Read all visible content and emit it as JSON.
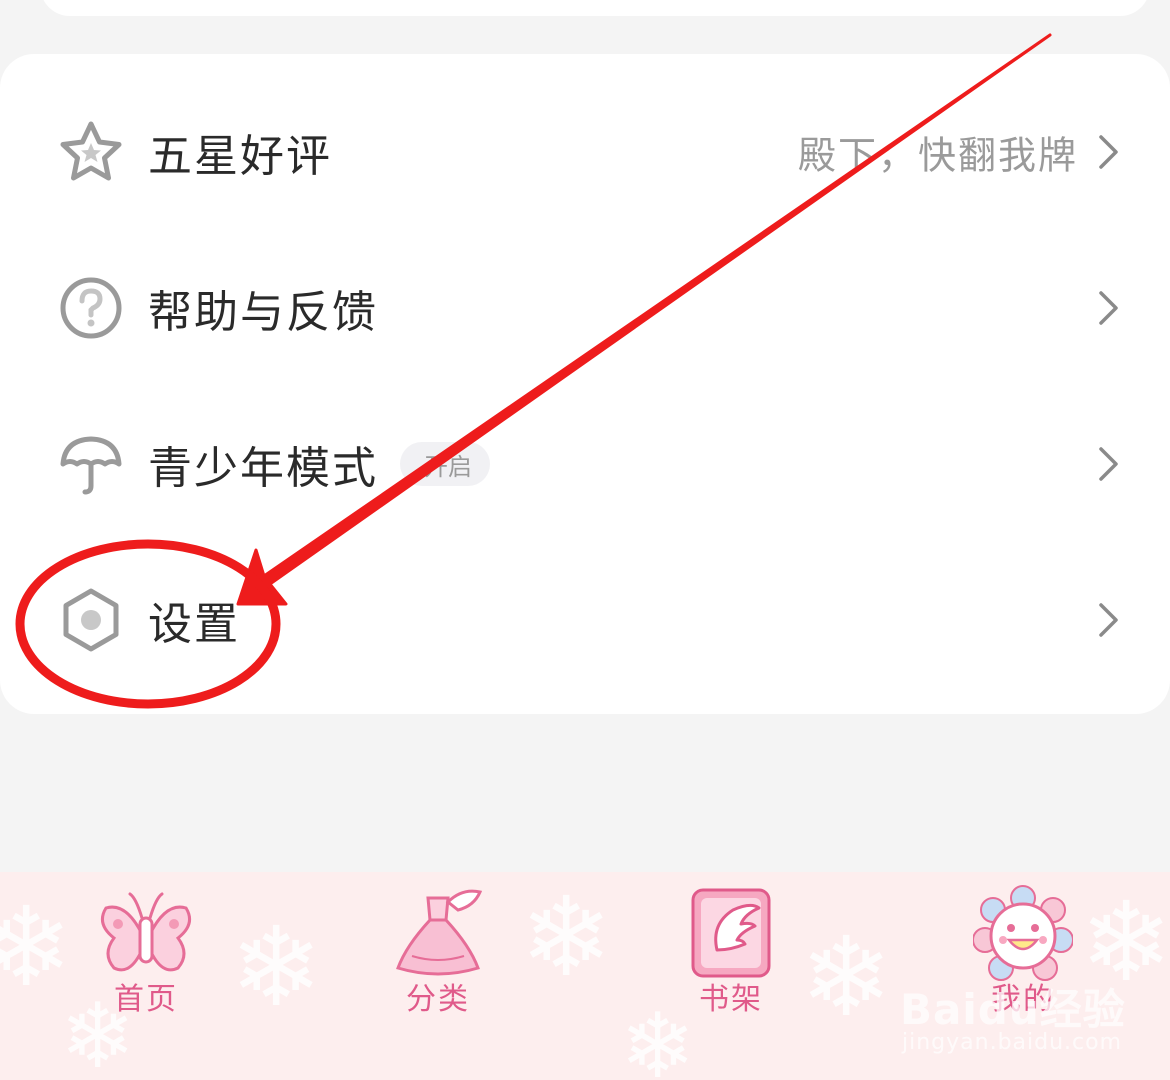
{
  "menu": {
    "items": [
      {
        "icon": "star-icon",
        "label": "五星好评",
        "subtitle": "殿下，快翻我牌"
      },
      {
        "icon": "help-circle-icon",
        "label": "帮助与反馈"
      },
      {
        "icon": "umbrella-icon",
        "label": "青少年模式",
        "badge": "开启"
      },
      {
        "icon": "settings-hexagon-icon",
        "label": "设置"
      }
    ]
  },
  "tabbar": {
    "tabs": [
      {
        "icon": "butterfly-icon",
        "label": "首页"
      },
      {
        "icon": "dress-icon",
        "label": "分类"
      },
      {
        "icon": "wing-book-icon",
        "label": "书架"
      },
      {
        "icon": "sun-face-icon",
        "label": "我的"
      }
    ]
  },
  "watermark": {
    "brand": "Baidu经验",
    "url": "jingyan.baidu.com"
  },
  "colors": {
    "accent_pink": "#e05a8a",
    "tabbar_bg": "#fdeeee",
    "annotation_red": "#ee1c1c",
    "icon_gray": "#9a9a9a"
  }
}
